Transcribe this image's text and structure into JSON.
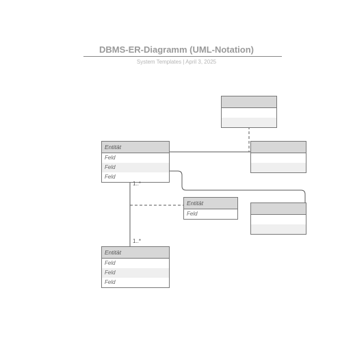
{
  "header": {
    "title": "DBMS-ER-Diagramm (UML-Notation)",
    "subtitle": "System Templates  |  April 3, 2025"
  },
  "entities": {
    "e1": {
      "name": "Entität",
      "fields": [
        "Feld",
        "Feld",
        "Feld"
      ]
    },
    "e2": {
      "name": "",
      "fields": [
        "",
        ""
      ]
    },
    "e3": {
      "name": "",
      "fields": [
        "",
        ""
      ]
    },
    "e4": {
      "name": "Entität",
      "fields": [
        "Feld"
      ]
    },
    "e5": {
      "name": "",
      "fields": [
        "",
        ""
      ]
    },
    "e6": {
      "name": "Entität",
      "fields": [
        "Feld",
        "Feld",
        "Feld"
      ]
    }
  },
  "multiplicities": {
    "m1": "1..*",
    "m2": "1..*"
  }
}
